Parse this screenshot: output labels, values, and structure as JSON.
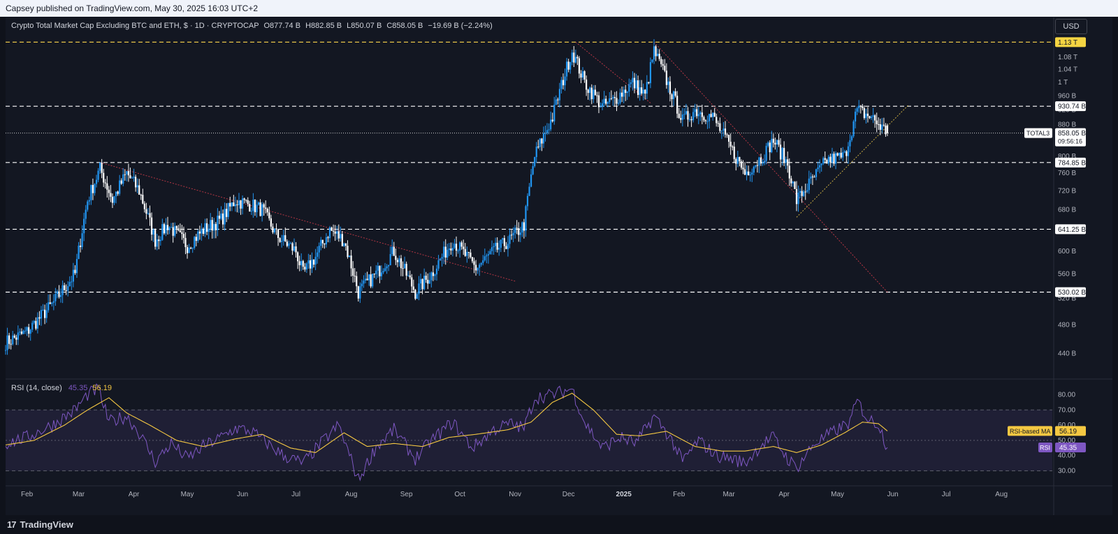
{
  "header": {
    "published": "Capsey published on TradingView.com, May 30, 2025 16:03 UTC+2"
  },
  "legend": {
    "symbol": "Crypto Total Market Cap Excluding BTC and ETH, $ · 1D · CRYPTOCAP",
    "open": "O877.74 B",
    "high": "H882.85 B",
    "low": "L850.07 B",
    "close": "C858.05 B",
    "change": "−19.69 B (−2.24%)"
  },
  "currency_button": "USD",
  "footer": {
    "brand": "TradingView",
    "logo_mark": "17"
  },
  "rsi": {
    "title": "RSI (14, close)",
    "value": "45.35",
    "ma_value": "56.19",
    "ma_label": "RSI-based MA",
    "rsi_label": "RSI",
    "ma_tag": "56.19",
    "rsi_tag": "45.35"
  },
  "price_tags": {
    "symbol_tag": "TOTAL3",
    "last_price": "858.05 B",
    "countdown": "09:56:16",
    "level_tags": [
      "1.13 T",
      "930.74 B",
      "784.85 B",
      "641.25 B",
      "530.02 B"
    ]
  },
  "colors": {
    "background": "#131722",
    "up_candle": "#2196f3",
    "down_candle": "#ffffff",
    "rsi_line": "#7e57c2",
    "rsi_ma": "#f5c842",
    "trendline_red": "#d23c4a",
    "trendline_yellow": "#e8c547",
    "level_line": "#ffffff"
  },
  "chart_data": [
    {
      "type": "candlestick",
      "title": "Crypto Total Market Cap Excluding BTC and ETH, $ · 1D · CRYPTOCAP",
      "x_ticks": [
        "Feb",
        "Mar",
        "Apr",
        "May",
        "Jun",
        "Jul",
        "Aug",
        "Sep",
        "Oct",
        "Nov",
        "Dec",
        "2025",
        "Feb",
        "Mar",
        "Apr",
        "May",
        "Jun",
        "Jul",
        "Aug"
      ],
      "y_ticks": [
        "1.08 T",
        "1.04 T",
        "1 T",
        "960 B",
        "920 B",
        "880 B",
        "800 B",
        "760 B",
        "720 B",
        "680 B",
        "600 B",
        "560 B",
        "520 B",
        "480 B",
        "440 B"
      ],
      "ylim": [
        410,
        1160
      ],
      "y_unit": "B USD",
      "grid": false,
      "horizontal_levels": [
        1130,
        930.74,
        784.85,
        641.25,
        530.02
      ],
      "last_price": 858.05,
      "ohlc_last": {
        "open": 877.74,
        "high": 882.85,
        "low": 850.07,
        "close": 858.05
      },
      "close_anchors": [
        [
          "2024-01-20",
          455
        ],
        [
          "2024-02-01",
          470
        ],
        [
          "2024-02-15",
          510
        ],
        [
          "2024-02-28",
          560
        ],
        [
          "2024-03-06",
          700
        ],
        [
          "2024-03-13",
          770
        ],
        [
          "2024-03-20",
          700
        ],
        [
          "2024-03-28",
          760
        ],
        [
          "2024-04-04",
          720
        ],
        [
          "2024-04-13",
          620
        ],
        [
          "2024-04-20",
          650
        ],
        [
          "2024-05-01",
          610
        ],
        [
          "2024-05-10",
          640
        ],
        [
          "2024-05-20",
          660
        ],
        [
          "2024-05-28",
          700
        ],
        [
          "2024-06-06",
          690
        ],
        [
          "2024-06-12",
          680
        ],
        [
          "2024-06-20",
          630
        ],
        [
          "2024-07-01",
          600
        ],
        [
          "2024-07-05",
          560
        ],
        [
          "2024-07-12",
          590
        ],
        [
          "2024-07-20",
          640
        ],
        [
          "2024-07-28",
          620
        ],
        [
          "2024-08-05",
          530
        ],
        [
          "2024-08-15",
          560
        ],
        [
          "2024-08-25",
          600
        ],
        [
          "2024-09-06",
          530
        ],
        [
          "2024-09-15",
          560
        ],
        [
          "2024-09-27",
          620
        ],
        [
          "2024-10-10",
          570
        ],
        [
          "2024-10-20",
          600
        ],
        [
          "2024-10-29",
          620
        ],
        [
          "2024-11-06",
          650
        ],
        [
          "2024-11-12",
          800
        ],
        [
          "2024-11-22",
          900
        ],
        [
          "2024-12-03",
          1100
        ],
        [
          "2024-12-10",
          1000
        ],
        [
          "2024-12-20",
          930
        ],
        [
          "2024-12-27",
          950
        ],
        [
          "2025-01-06",
          1000
        ],
        [
          "2025-01-13",
          960
        ],
        [
          "2025-01-18",
          1100
        ],
        [
          "2025-01-27",
          980
        ],
        [
          "2025-02-03",
          890
        ],
        [
          "2025-02-10",
          920
        ],
        [
          "2025-02-20",
          900
        ],
        [
          "2025-03-02",
          820
        ],
        [
          "2025-03-10",
          760
        ],
        [
          "2025-03-20",
          800
        ],
        [
          "2025-03-26",
          840
        ],
        [
          "2025-04-03",
          780
        ],
        [
          "2025-04-08",
          700
        ],
        [
          "2025-04-16",
          740
        ],
        [
          "2025-04-25",
          790
        ],
        [
          "2025-05-05",
          800
        ],
        [
          "2025-05-12",
          920
        ],
        [
          "2025-05-20",
          900
        ],
        [
          "2025-05-29",
          858
        ]
      ]
    },
    {
      "type": "line",
      "title": "RSI (14, close)",
      "y_ticks": [
        "80.00",
        "70.00",
        "60.00",
        "50.00",
        "40.00",
        "30.00"
      ],
      "ylim": [
        22,
        88
      ],
      "band": [
        30,
        70
      ],
      "series": [
        {
          "name": "RSI",
          "points": [
            [
              "2024-01-20",
              48
            ],
            [
              "2024-02-01",
              52
            ],
            [
              "2024-02-15",
              60
            ],
            [
              "2024-02-28",
              70
            ],
            [
              "2024-03-06",
              80
            ],
            [
              "2024-03-12",
              84
            ],
            [
              "2024-03-18",
              62
            ],
            [
              "2024-03-28",
              66
            ],
            [
              "2024-04-04",
              55
            ],
            [
              "2024-04-13",
              36
            ],
            [
              "2024-04-22",
              48
            ],
            [
              "2024-05-01",
              38
            ],
            [
              "2024-05-10",
              46
            ],
            [
              "2024-05-20",
              52
            ],
            [
              "2024-05-28",
              58
            ],
            [
              "2024-06-06",
              56
            ],
            [
              "2024-06-15",
              48
            ],
            [
              "2024-06-24",
              40
            ],
            [
              "2024-07-05",
              35
            ],
            [
              "2024-07-15",
              48
            ],
            [
              "2024-07-25",
              60
            ],
            [
              "2024-08-05",
              24
            ],
            [
              "2024-08-15",
              46
            ],
            [
              "2024-08-25",
              57
            ],
            [
              "2024-09-06",
              38
            ],
            [
              "2024-09-15",
              50
            ],
            [
              "2024-09-27",
              62
            ],
            [
              "2024-10-08",
              45
            ],
            [
              "2024-10-20",
              57
            ],
            [
              "2024-10-29",
              61
            ],
            [
              "2024-11-06",
              58
            ],
            [
              "2024-11-12",
              78
            ],
            [
              "2024-11-22",
              80
            ],
            [
              "2024-12-03",
              84
            ],
            [
              "2024-12-10",
              62
            ],
            [
              "2024-12-20",
              45
            ],
            [
              "2024-12-30",
              52
            ],
            [
              "2025-01-08",
              48
            ],
            [
              "2025-01-18",
              66
            ],
            [
              "2025-01-27",
              52
            ],
            [
              "2025-02-03",
              36
            ],
            [
              "2025-02-12",
              50
            ],
            [
              "2025-02-22",
              40
            ],
            [
              "2025-03-03",
              38
            ],
            [
              "2025-03-10",
              35
            ],
            [
              "2025-03-20",
              48
            ],
            [
              "2025-03-26",
              52
            ],
            [
              "2025-04-03",
              38
            ],
            [
              "2025-04-08",
              32
            ],
            [
              "2025-04-18",
              48
            ],
            [
              "2025-04-28",
              55
            ],
            [
              "2025-05-08",
              62
            ],
            [
              "2025-05-12",
              76
            ],
            [
              "2025-05-18",
              64
            ],
            [
              "2025-05-24",
              61
            ],
            [
              "2025-05-29",
              45.35
            ]
          ]
        },
        {
          "name": "RSI-based MA",
          "points": [
            [
              "2024-01-20",
              47
            ],
            [
              "2024-02-05",
              50
            ],
            [
              "2024-02-22",
              60
            ],
            [
              "2024-03-06",
              70
            ],
            [
              "2024-03-18",
              78
            ],
            [
              "2024-03-28",
              68
            ],
            [
              "2024-04-10",
              60
            ],
            [
              "2024-04-25",
              50
            ],
            [
              "2024-05-10",
              46
            ],
            [
              "2024-05-28",
              51
            ],
            [
              "2024-06-12",
              54
            ],
            [
              "2024-06-28",
              45
            ],
            [
              "2024-07-12",
              42
            ],
            [
              "2024-07-28",
              55
            ],
            [
              "2024-08-10",
              46
            ],
            [
              "2024-08-25",
              48
            ],
            [
              "2024-09-10",
              46
            ],
            [
              "2024-09-25",
              52
            ],
            [
              "2024-10-10",
              54
            ],
            [
              "2024-10-28",
              57
            ],
            [
              "2024-11-10",
              62
            ],
            [
              "2024-11-22",
              75
            ],
            [
              "2024-12-03",
              81
            ],
            [
              "2024-12-15",
              70
            ],
            [
              "2024-12-28",
              54
            ],
            [
              "2025-01-10",
              53
            ],
            [
              "2025-01-25",
              56
            ],
            [
              "2025-02-10",
              46
            ],
            [
              "2025-02-25",
              43
            ],
            [
              "2025-03-10",
              43
            ],
            [
              "2025-03-26",
              46
            ],
            [
              "2025-04-08",
              42
            ],
            [
              "2025-04-22",
              47
            ],
            [
              "2025-05-05",
              55
            ],
            [
              "2025-05-15",
              62
            ],
            [
              "2025-05-24",
              61
            ],
            [
              "2025-05-29",
              56.19
            ]
          ]
        }
      ]
    }
  ]
}
